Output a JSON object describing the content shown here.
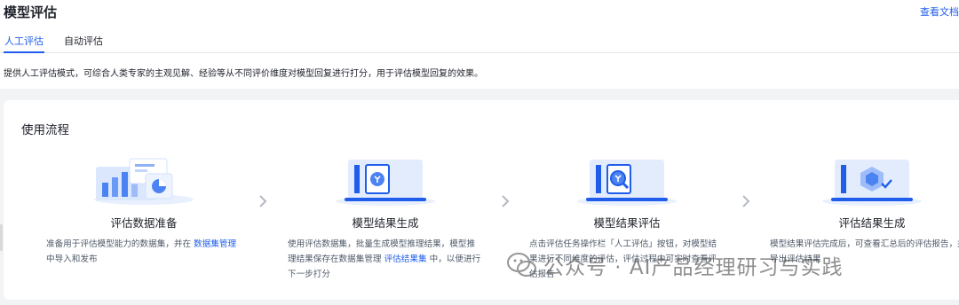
{
  "header": {
    "title": "模型评估",
    "doc_link": "查看文档"
  },
  "tabs": [
    {
      "label": "人工评估",
      "active": true
    },
    {
      "label": "自动评估",
      "active": false
    }
  ],
  "description": "提供人工评估模式，可综合人类专家的主观见解、经验等从不同评价维度对模型回复进行打分，用于评估模型回复的效果。",
  "process": {
    "title": "使用流程",
    "steps": [
      {
        "title": "评估数据准备",
        "desc_before": "准备用于评估模型能力的数据集，并在 ",
        "link": "数据集管理",
        "desc_after": " 中导入和发布"
      },
      {
        "title": "模型结果生成",
        "desc_before": "使用评估数据集，批量生成模型推理结果，模型推理结果保存在数据集管理 ",
        "link": "评估结果集",
        "desc_after": " 中，以便进行下一步打分"
      },
      {
        "title": "模型结果评估",
        "desc_before": "点击评估任务操作栏「人工评估」按钮，对模型结果进行不同维度的评估，评估过程中可实时查看评估报告",
        "link": "",
        "desc_after": ""
      },
      {
        "title": "评估结果生成",
        "desc_before": "模型结果评估完成后，可查看汇总后的评估报告，并导出评估结果",
        "link": "",
        "desc_after": ""
      }
    ]
  },
  "watermark": "公众号 · AI产品经理研习与实践",
  "colors": {
    "accent": "#1f5dea",
    "text": "#1d2129",
    "muted": "#4e5969",
    "bg": "#f2f3f5"
  }
}
